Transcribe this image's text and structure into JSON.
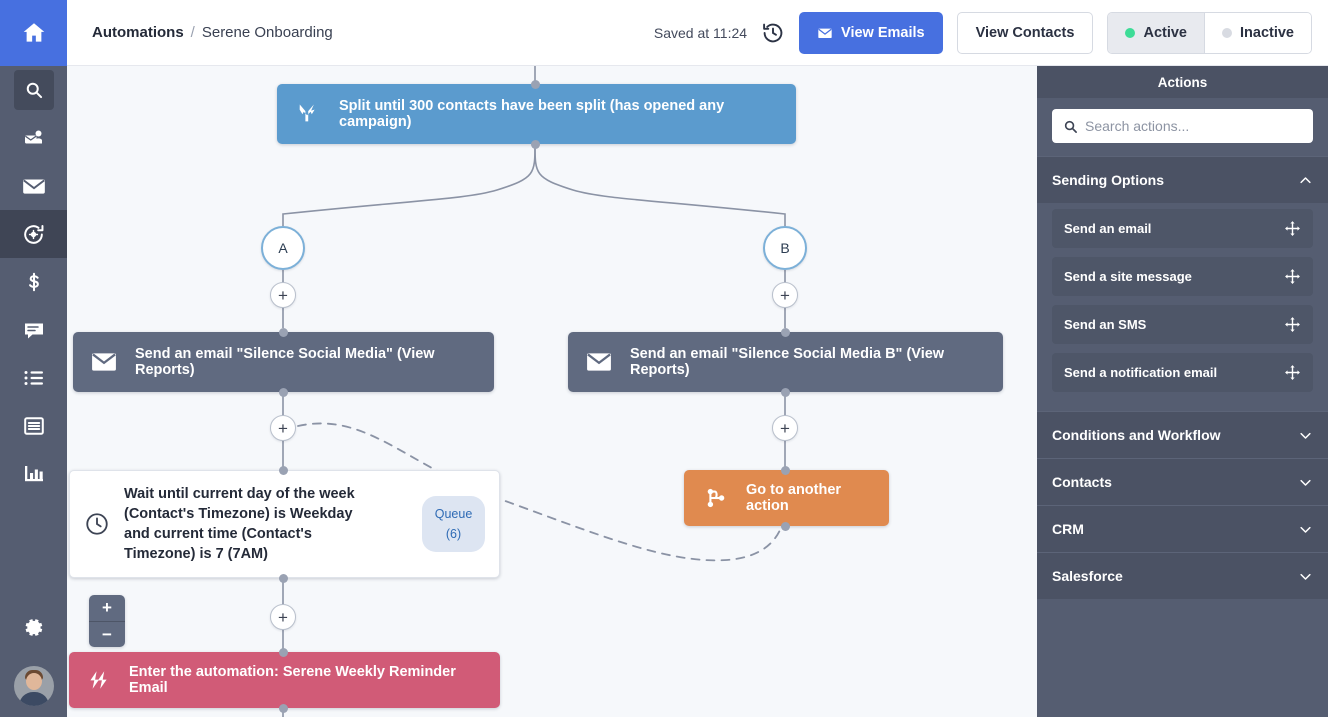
{
  "header": {
    "breadcrumb_root": "Automations",
    "breadcrumb_sep": "/",
    "breadcrumb_leaf": "Serene Onboarding",
    "saved_text": "Saved at 11:24",
    "history_icon": "history-clock-icon",
    "view_emails_label": "View Emails",
    "view_emails_icon": "envelope-icon",
    "view_contacts_label": "View Contacts",
    "status_active_label": "Active",
    "status_inactive_label": "Inactive",
    "status_selected": "Active",
    "active_dot_color": "#3ddc97",
    "inactive_dot_color": "#d8dbe2",
    "primary_color": "#4770e0"
  },
  "rail": {
    "items": [
      {
        "name": "home-icon",
        "active": true
      },
      {
        "name": "search-icon",
        "active": false,
        "boxed": true
      },
      {
        "name": "contacts-icon",
        "active": false
      },
      {
        "name": "campaigns-envelope-icon",
        "active": false
      },
      {
        "name": "automations-icon",
        "active": true
      },
      {
        "name": "deals-dollar-icon",
        "active": false
      },
      {
        "name": "conversations-icon",
        "active": false
      },
      {
        "name": "lists-icon",
        "active": false
      },
      {
        "name": "forms-icon",
        "active": false
      },
      {
        "name": "reports-bar-chart-icon",
        "active": false
      }
    ],
    "settings_icon": "gear-icon",
    "avatar": "user-avatar"
  },
  "canvas": {
    "zoom_in_label": "+",
    "zoom_out_label": "−",
    "add_label": "+",
    "nodes": {
      "split": {
        "label": "Split until 300 contacts have been split (has opened any campaign)",
        "icon": "split-fork-icon",
        "color": "#5b9bce"
      },
      "branch_a": {
        "label": "A"
      },
      "branch_b": {
        "label": "B"
      },
      "email_a": {
        "label": "Send an email \"Silence Social Media\" (View Reports)",
        "icon": "envelope-icon",
        "color": "#606a80"
      },
      "email_b": {
        "label": "Send an email \"Silence Social Media B\" (View Reports)",
        "icon": "envelope-icon",
        "color": "#606a80"
      },
      "wait": {
        "label": "Wait until current day of the week (Contact's Timezone) is Weekday and current time (Contact's Timezone) is 7 (7AM)",
        "icon": "clock-icon",
        "queue_label": "Queue",
        "queue_count": "(6)"
      },
      "goto": {
        "label": "Go to another action",
        "icon": "goto-branch-icon",
        "color": "#e08a4f"
      },
      "enter": {
        "label": "Enter the automation: Serene Weekly Reminder Email",
        "icon": "lightning-automation-icon",
        "color": "#d15b77"
      }
    }
  },
  "panel": {
    "title": "Actions",
    "search_placeholder": "Search actions...",
    "search_value": "",
    "search_icon": "search-icon",
    "groups": [
      {
        "label": "Sending Options",
        "expanded": true,
        "chevron": "chevron-up-icon",
        "items": [
          {
            "label": "Send an email",
            "drag": "drag-move-icon"
          },
          {
            "label": "Send a site message",
            "drag": "drag-move-icon"
          },
          {
            "label": "Send an SMS",
            "drag": "drag-move-icon"
          },
          {
            "label": "Send a notification email",
            "drag": "drag-move-icon"
          }
        ]
      },
      {
        "label": "Conditions and Workflow",
        "expanded": false,
        "chevron": "chevron-down-icon",
        "items": []
      },
      {
        "label": "Contacts",
        "expanded": false,
        "chevron": "chevron-down-icon",
        "items": []
      },
      {
        "label": "CRM",
        "expanded": false,
        "chevron": "chevron-down-icon",
        "items": []
      },
      {
        "label": "Salesforce",
        "expanded": false,
        "chevron": "chevron-down-icon",
        "items": []
      }
    ]
  }
}
